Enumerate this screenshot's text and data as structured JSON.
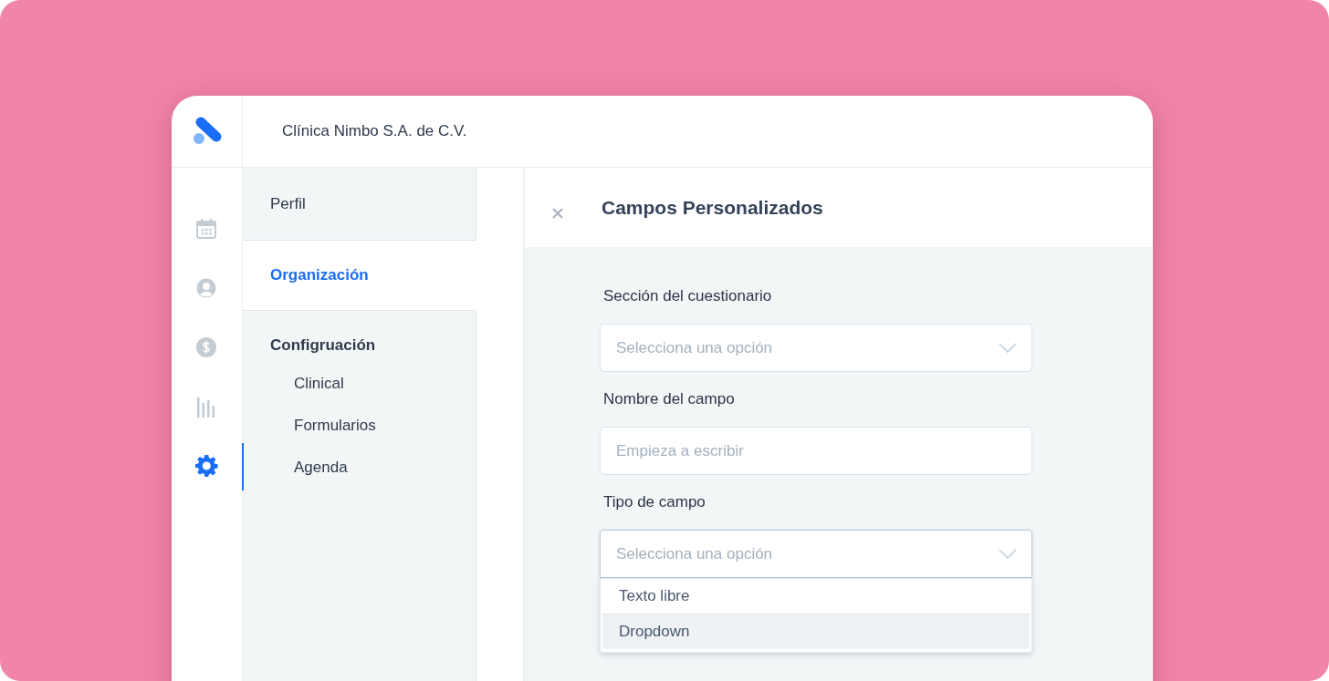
{
  "header": {
    "org_name": "Clínica Nimbo S.A. de C.V."
  },
  "rail": [
    {
      "selected": false
    },
    {
      "selected": false
    },
    {
      "selected": false
    },
    {
      "selected": false
    },
    {
      "selected": true
    }
  ],
  "settings_nav": [
    {
      "label": "Perfil",
      "selected": false
    },
    {
      "label": "Organización",
      "selected": true
    },
    {
      "label": "Configruación",
      "selected": false,
      "children": [
        {
          "label": "Clinical",
          "selected": false
        },
        {
          "label": "Formularios",
          "selected": false
        },
        {
          "label": "Agenda",
          "selected": false
        }
      ]
    }
  ],
  "panel": {
    "title": "Campos Personalizados",
    "fields": [
      {
        "kind": "select",
        "label": "Sección del cuestionario",
        "placeholder": "Selecciona una opción",
        "expanded": false
      },
      {
        "kind": "text",
        "label": "Nombre del campo",
        "placeholder": "Empieza a escribir"
      },
      {
        "kind": "select",
        "label": "Tipo de campo",
        "placeholder": "Selecciona una opción",
        "expanded": true,
        "options": [
          {
            "label": "Texto libre",
            "selected": false
          },
          {
            "label": "Dropdown",
            "selected": true
          }
        ]
      }
    ]
  }
}
